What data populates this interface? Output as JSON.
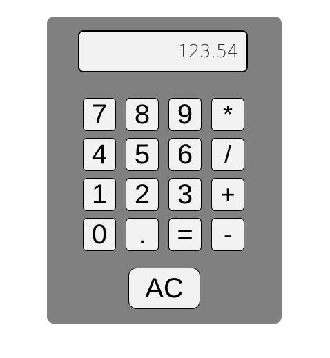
{
  "display": {
    "value": "123.54"
  },
  "keypad": {
    "rows": [
      [
        "7",
        "8",
        "9",
        "*"
      ],
      [
        "4",
        "5",
        "6",
        "/"
      ],
      [
        "1",
        "2",
        "3",
        "+"
      ],
      [
        "0",
        ".",
        "=",
        "-"
      ]
    ]
  },
  "clear": {
    "label": "AC"
  },
  "colors": {
    "body": "#808080",
    "key_face": "#f2f2f2",
    "border": "#000000"
  }
}
